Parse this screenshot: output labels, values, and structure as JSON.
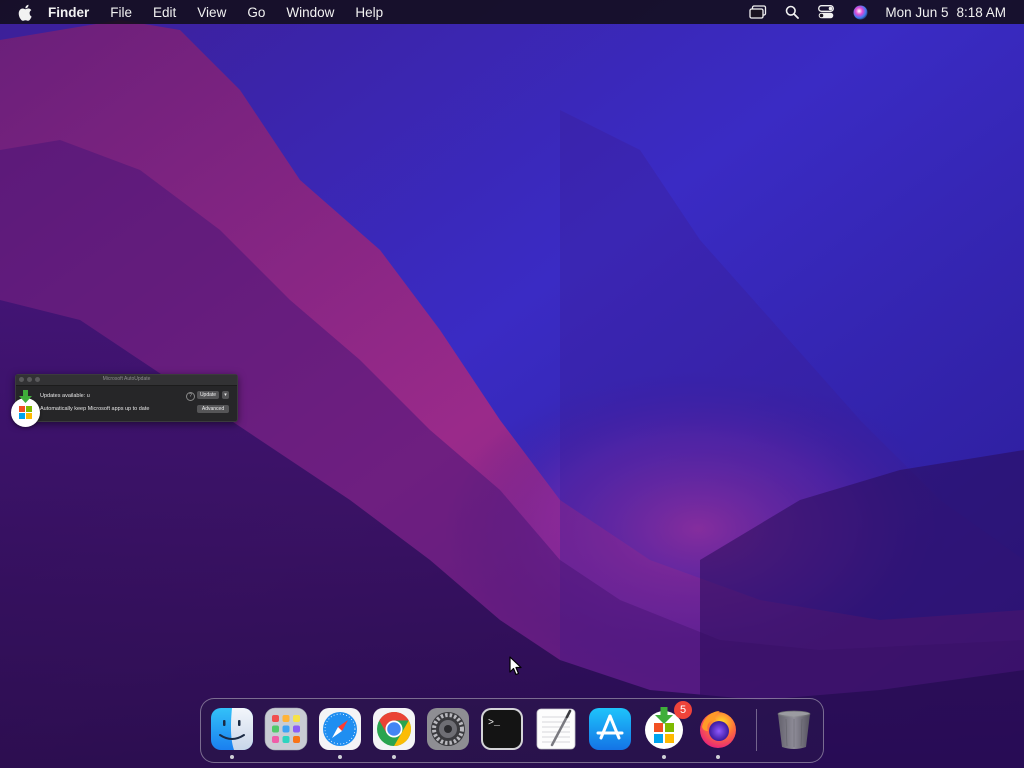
{
  "menubar": {
    "app_name": "Finder",
    "menus": [
      "File",
      "Edit",
      "View",
      "Go",
      "Window",
      "Help"
    ],
    "status_icons": [
      "screen-mirroring-icon",
      "spotlight-search-icon",
      "control-center-icon",
      "siri-icon"
    ],
    "clock": {
      "date": "Mon Jun 5",
      "time": "8:18 AM"
    }
  },
  "mau_window": {
    "title": "Microsoft AutoUpdate",
    "update_text": "Updates available: u",
    "auto_text": "Automatically keep Microsoft apps up to date",
    "help_label": "?",
    "update_button": "Update",
    "more_button": "▾",
    "advanced_button": "Advanced"
  },
  "dock": {
    "items": [
      {
        "name": "Finder",
        "icon": "finder-icon",
        "running": true
      },
      {
        "name": "Launchpad",
        "icon": "launchpad-icon",
        "running": false
      },
      {
        "name": "Safari",
        "icon": "safari-icon",
        "running": true
      },
      {
        "name": "Google Chrome",
        "icon": "chrome-icon",
        "running": true
      },
      {
        "name": "System Preferences",
        "icon": "system-preferences-icon",
        "running": false
      },
      {
        "name": "Terminal",
        "icon": "terminal-icon",
        "running": false
      },
      {
        "name": "TextEdit",
        "icon": "textedit-icon",
        "running": false
      },
      {
        "name": "App Store",
        "icon": "app-store-icon",
        "running": false
      },
      {
        "name": "Microsoft AutoUpdate",
        "icon": "microsoft-autoupdate-icon",
        "running": true,
        "badge": "5"
      },
      {
        "name": "Firefox",
        "icon": "firefox-icon",
        "running": true
      },
      {
        "name": "Trash",
        "icon": "trash-icon",
        "running": false
      }
    ]
  },
  "colors": {
    "wallpaper_top": "#2b1f9c",
    "wallpaper_magenta": "#b02a86",
    "wallpaper_dark": "#1a0a3c",
    "badge": "#f0433a"
  }
}
